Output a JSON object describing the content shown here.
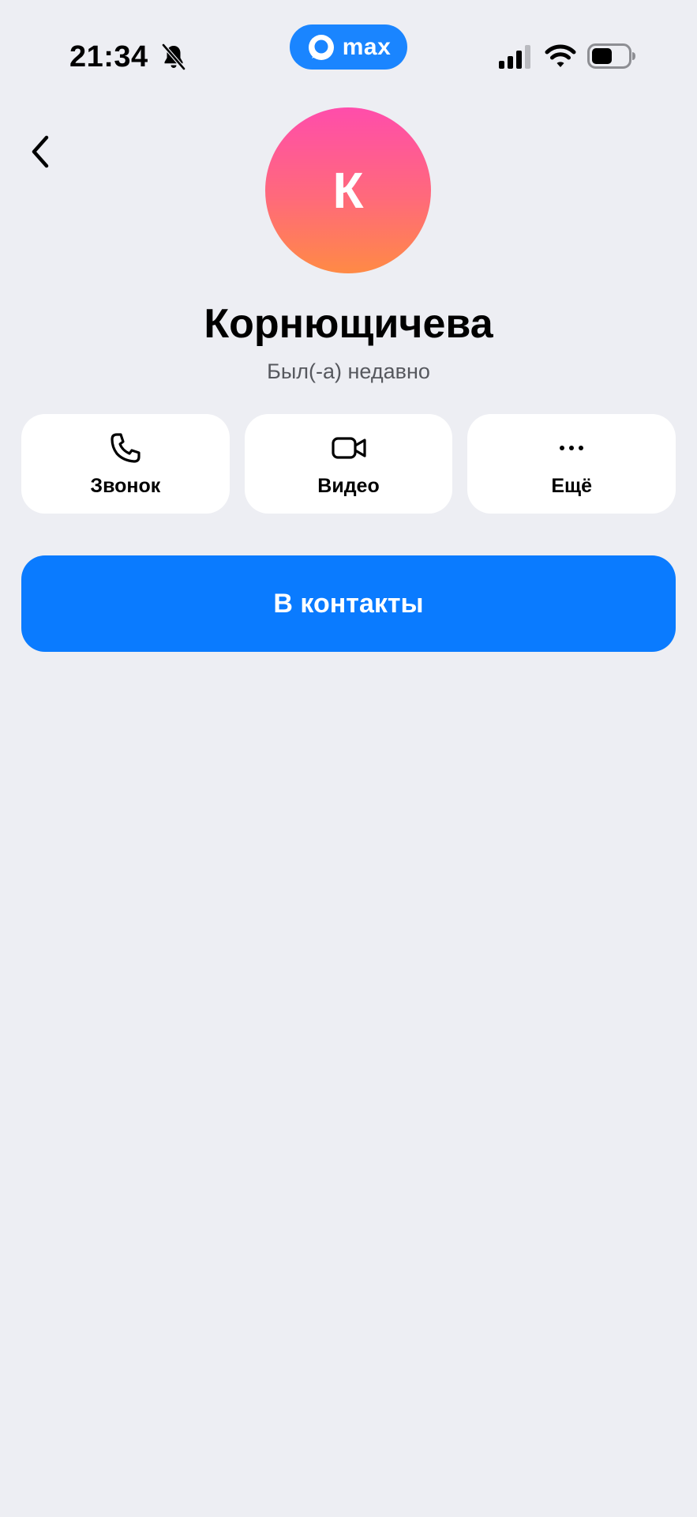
{
  "status_bar": {
    "time": "21:34",
    "app_name": "max",
    "icons": [
      "bell-slash-icon",
      "signal-icon",
      "wifi-icon",
      "battery-icon"
    ]
  },
  "header": {
    "back_icon": "chevron-left-icon"
  },
  "profile": {
    "avatar_letter": "К",
    "name": "Корнющичева",
    "status": "Был(-а) недавно"
  },
  "actions": [
    {
      "label": "Звонок",
      "icon": "phone-icon"
    },
    {
      "label": "Видео",
      "icon": "video-camera-icon"
    },
    {
      "label": "Ещё",
      "icon": "more-dots-icon"
    }
  ],
  "primary_button": {
    "label": "В контакты"
  },
  "colors": {
    "background": "#edeef3",
    "accent": "#0a7bff",
    "avatar_gradient_top": "#ff4dab",
    "avatar_gradient_bottom": "#ff8a45",
    "card": "#ffffff",
    "secondary_text": "#56585e"
  }
}
